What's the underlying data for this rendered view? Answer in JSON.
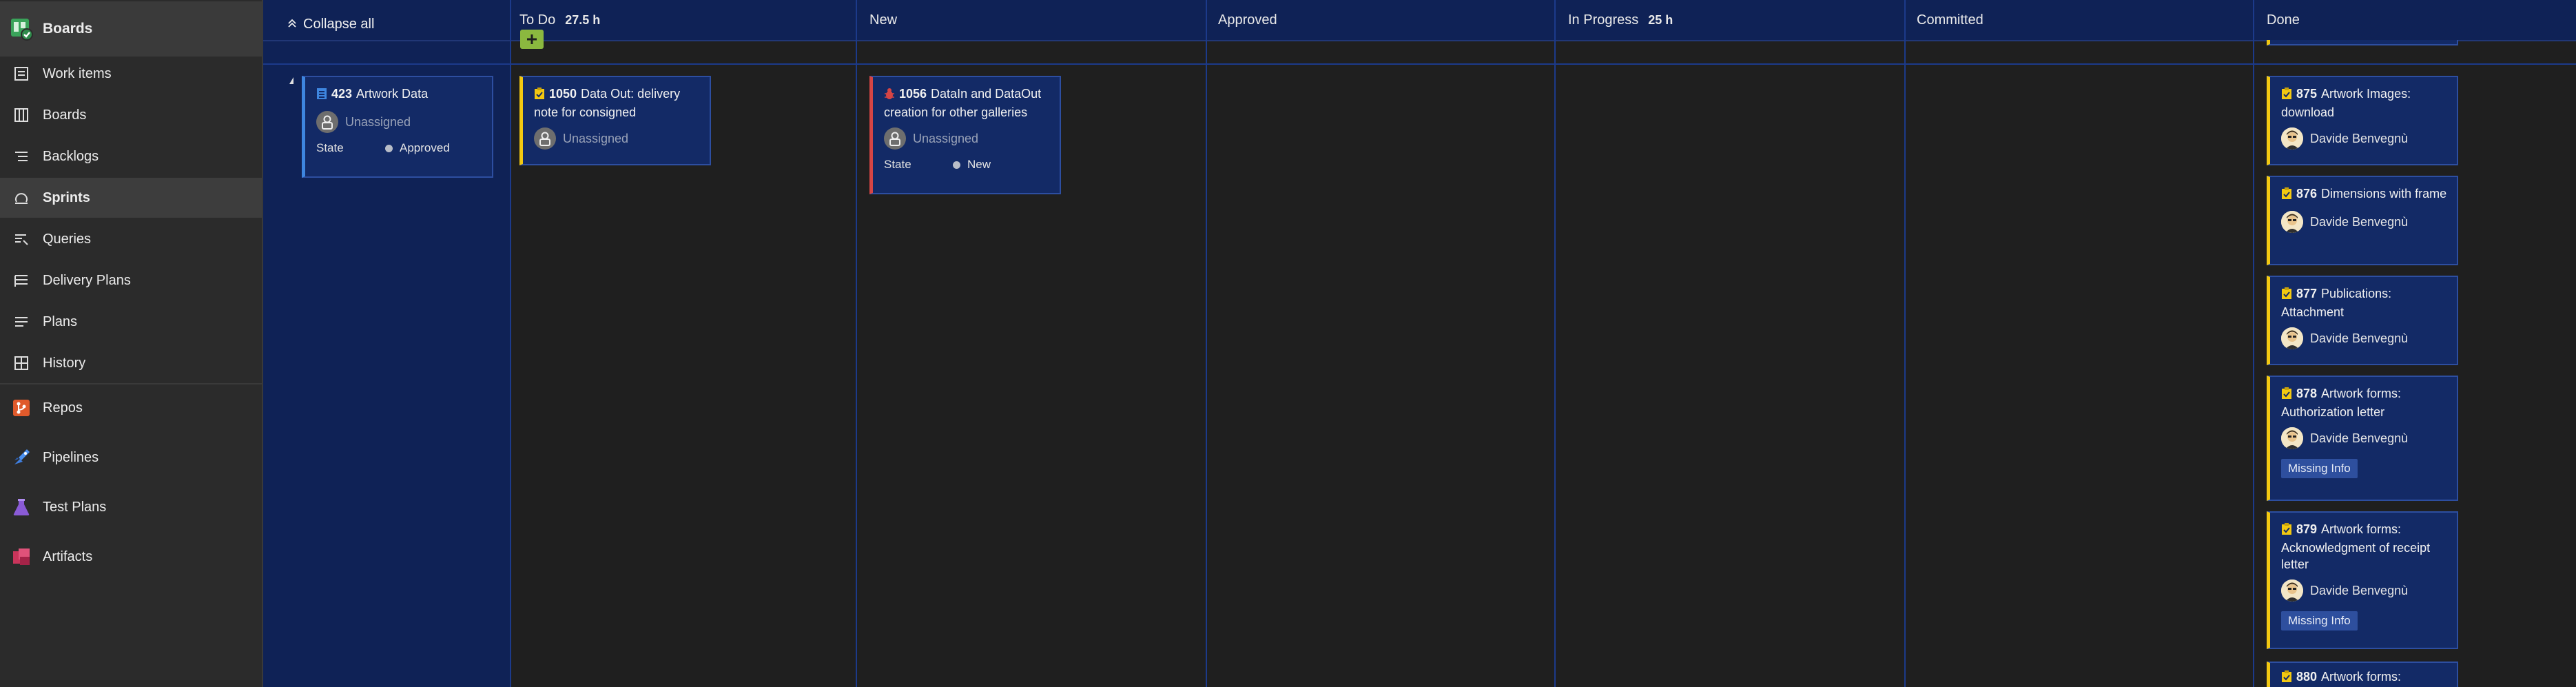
{
  "nav": {
    "hub_label": "Boards",
    "items": [
      {
        "label": "Work items"
      },
      {
        "label": "Boards"
      },
      {
        "label": "Backlogs"
      },
      {
        "label": "Sprints"
      },
      {
        "label": "Queries"
      },
      {
        "label": "Delivery Plans"
      },
      {
        "label": "Plans"
      },
      {
        "label": "History"
      },
      {
        "label": "Repos"
      },
      {
        "label": "Pipelines"
      },
      {
        "label": "Test Plans"
      },
      {
        "label": "Artifacts"
      }
    ],
    "active": "Sprints"
  },
  "board": {
    "collapse_label": "Collapse all",
    "columns": [
      {
        "name": "To Do",
        "hours": "27.5 h"
      },
      {
        "name": "New",
        "hours": ""
      },
      {
        "name": "Approved",
        "hours": ""
      },
      {
        "name": "In Progress",
        "hours": "25 h"
      },
      {
        "name": "Committed",
        "hours": ""
      },
      {
        "name": "Done",
        "hours": ""
      }
    ],
    "state_label": "State",
    "parent": {
      "id": "423",
      "title": "Artwork Data",
      "assignee": "Unassigned",
      "state": "Approved"
    },
    "todo_card": {
      "id": "1050",
      "title": "Data Out: delivery note for consigned",
      "assignee": "Unassigned"
    },
    "new_card": {
      "id": "1056",
      "title": "DataIn and DataOut creation for other galleries",
      "assignee": "Unassigned",
      "state": "New"
    },
    "done_cards": [
      {
        "id": "875",
        "title": "Artwork Images: download",
        "assignee": "Davide Benvegnù",
        "tag": ""
      },
      {
        "id": "876",
        "title": "Dimensions with frame",
        "assignee": "Davide Benvegnù",
        "tag": ""
      },
      {
        "id": "877",
        "title": "Publications: Attachment",
        "assignee": "Davide Benvegnù",
        "tag": ""
      },
      {
        "id": "878",
        "title": "Artwork forms: Authorization letter",
        "assignee": "Davide Benvegnù",
        "tag": "Missing Info"
      },
      {
        "id": "879",
        "title": "Artwork forms: Acknowledgment of receipt letter",
        "assignee": "Davide Benvegnù",
        "tag": "Missing Info"
      },
      {
        "id": "880",
        "title": "Artwork forms:",
        "assignee": "",
        "tag": ""
      }
    ]
  },
  "colors": {
    "board_blue": "#132a66",
    "header_blue": "#0f2256",
    "task_yellow": "#f2c811",
    "bug_red": "#d64545",
    "pbi_blue": "#3e86e0",
    "add_green": "#8bb83f"
  }
}
